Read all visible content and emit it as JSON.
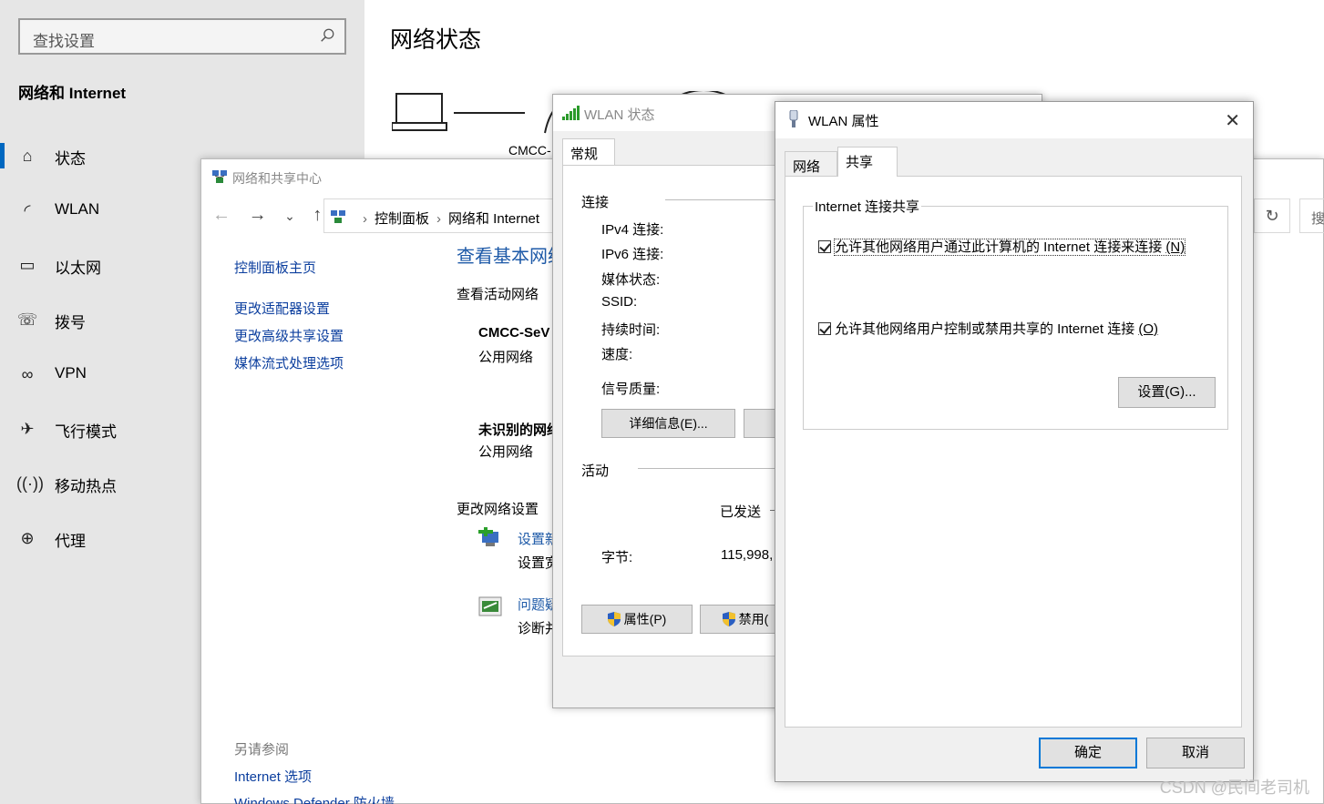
{
  "settings": {
    "search_placeholder": "查找设置",
    "section_title": "网络和 Internet",
    "nav": [
      {
        "label": "状态",
        "icon": "home-icon"
      },
      {
        "label": "WLAN",
        "icon": "wifi-icon"
      },
      {
        "label": "以太网",
        "icon": "ethernet-icon"
      },
      {
        "label": "拨号",
        "icon": "dialup-icon"
      },
      {
        "label": "VPN",
        "icon": "vpn-icon"
      },
      {
        "label": "飞行模式",
        "icon": "airplane-icon"
      },
      {
        "label": "移动热点",
        "icon": "hotspot-icon"
      },
      {
        "label": "代理",
        "icon": "globe-icon"
      }
    ],
    "active_nav": "状态",
    "page_title": "网络状态",
    "network_name_partial": "CMCC-"
  },
  "nsc": {
    "window_title": "网络和共享中心",
    "breadcrumb": [
      "控制面板",
      "网络和 Internet"
    ],
    "search_partial": "搜",
    "left_links": [
      "控制面板主页",
      "更改适配器设置",
      "更改高级共享设置",
      "媒体流式处理选项"
    ],
    "heading": "查看基本网络",
    "active_networks_label": "查看活动网络",
    "networks": [
      {
        "name": "CMCC-SeV",
        "type": "公用网络"
      },
      {
        "name": "未识别的网络",
        "type": "公用网络"
      }
    ],
    "change_settings_label": "更改网络设置",
    "tasks": [
      {
        "link": "设置新",
        "desc": "设置宽"
      },
      {
        "link": "问题疑",
        "desc": "诊断并"
      }
    ],
    "see_also_label": "另请参阅",
    "see_also_links": [
      "Internet 选项",
      "Windows Defender 防火墙"
    ]
  },
  "wlan_status": {
    "window_title": "WLAN 状态",
    "tab": "常规",
    "connection_group": "连接",
    "fields": [
      "IPv4 连接:",
      "IPv6 连接:",
      "媒体状态:",
      "SSID:",
      "持续时间:",
      "速度:",
      "信号质量:"
    ],
    "details_button": "详细信息(E)...",
    "activity_group": "活动",
    "sent_label": "已发送",
    "bytes_label": "字节:",
    "bytes_sent": "115,998,",
    "properties_button": "属性(P)",
    "disable_button": "禁用("
  },
  "wlan_props": {
    "window_title": "WLAN 属性",
    "tabs": [
      "网络",
      "共享"
    ],
    "active_tab": "共享",
    "group_label": "Internet 连接共享",
    "checkbox1": {
      "text": "允许其他网络用户通过此计算机的 Internet 连接来连接",
      "key": "(N)",
      "checked": true
    },
    "checkbox2": {
      "text": "允许其他网络用户控制或禁用共享的 Internet 连接",
      "key": "(O)",
      "checked": true
    },
    "settings_button": "设置(G)...",
    "ok_button": "确定",
    "cancel_button": "取消"
  },
  "watermark": "CSDN @民间老司机"
}
